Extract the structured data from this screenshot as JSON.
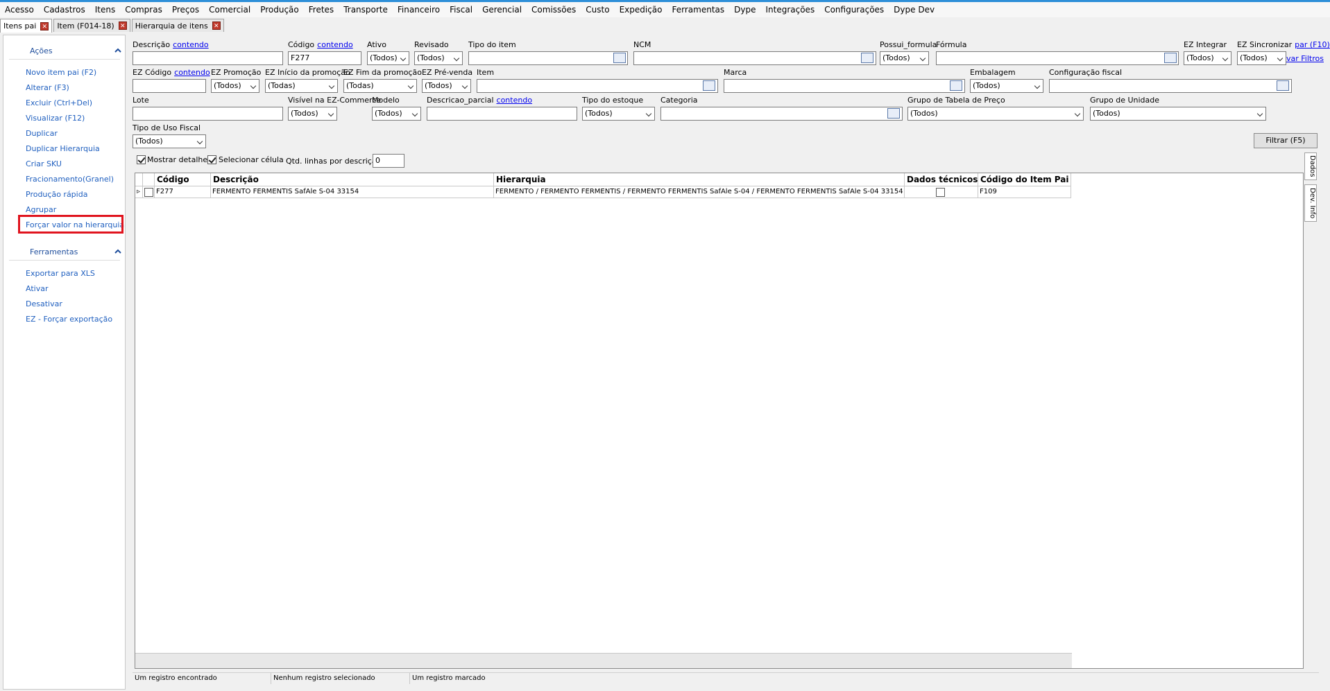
{
  "menu": [
    "Acesso",
    "Cadastros",
    "Itens",
    "Compras",
    "Preços",
    "Comercial",
    "Produção",
    "Fretes",
    "Transporte",
    "Financeiro",
    "Fiscal",
    "Gerencial",
    "Comissões",
    "Custo",
    "Expedição",
    "Ferramentas",
    "Dype",
    "Integrações",
    "Configurações",
    "Dype Dev"
  ],
  "tabs": [
    "Itens pai",
    "Item (F014-18)",
    "Hierarquia de itens"
  ],
  "sidebar": {
    "acoes_title": "Ações",
    "acoes": [
      "Novo item pai (F2)",
      "Alterar (F3)",
      "Excluir (Ctrl+Del)",
      "Visualizar (F12)",
      "Duplicar",
      "Duplicar Hierarquia",
      "Criar SKU",
      "Fracionamento(Granel)",
      "Produção rápida",
      "Agrupar",
      "Forçar valor na hierarquia"
    ],
    "ferramentas_title": "Ferramentas",
    "ferramentas": [
      "Exportar para XLS",
      "Ativar",
      "Desativar",
      "EZ - Forçar exportação"
    ]
  },
  "filters": {
    "descricao": "Descrição",
    "contendo": "contendo",
    "codigo": "Código",
    "codigo_value": "F277",
    "ativo": "Ativo",
    "revisado": "Revisado",
    "tipo_item": "Tipo do item",
    "ncm": "NCM",
    "possui_formula": "Possui_formula",
    "formula": "Fórmula",
    "ez_integrar": "EZ Integrar",
    "ez_sincronizar": "EZ Sincronizar",
    "par_f10": "par (F10)",
    "var_filtros": "var Filtros",
    "ez_codigo": "EZ Código",
    "ez_promocao": "EZ Promoção",
    "ez_inicio": "EZ Início da promoção",
    "ez_fim": "EZ Fim da promoção",
    "ez_prevenda": "EZ Pré-venda",
    "item": "Item",
    "marca": "Marca",
    "embalagem": "Embalagem",
    "config_fiscal": "Configuração fiscal",
    "lote": "Lote",
    "visivel": "Visível na EZ-Commerce",
    "modelo": "Modelo",
    "descricao_parcial": "Descricao_parcial",
    "tipo_estoque": "Tipo do estoque",
    "categoria": "Categoria",
    "grupo_tabela": "Grupo de Tabela de Preço",
    "grupo_unidade": "Grupo de Unidade",
    "tipo_uso_fiscal": "Tipo de Uso Fiscal",
    "todos": "(Todos)",
    "todas": "(Todas)",
    "filtrar": "Filtrar (F5)"
  },
  "options": {
    "mostrar_detalhe": "Mostrar detalhe",
    "selecionar_celula": "Selecionar célula",
    "qtd_linhas": "Qtd. linhas por descrição",
    "qtd_value": "0"
  },
  "grid": {
    "columns": [
      "Código",
      "Descrição",
      "Hierarquia",
      "Dados técnicos",
      "Código do Item Pai"
    ],
    "rows": [
      {
        "codigo": "F277",
        "descricao": "FERMENTO FERMENTIS SafAle S-04 33154",
        "hierarquia": "FERMENTO / FERMENTO FERMENTIS / FERMENTO FERMENTIS SafAle S-04 / FERMENTO FERMENTIS SafAle S-04 33154",
        "pai": "F109"
      }
    ]
  },
  "side_tabs": [
    "Dados",
    "Dev. Info"
  ],
  "status": [
    "Um registro encontrado",
    "Nenhum registro selecionado",
    "Um registro marcado"
  ],
  "colors": {
    "link": "#1f5fbf",
    "highlight": "#e0141e",
    "top_accent": "#2e8fd8"
  }
}
